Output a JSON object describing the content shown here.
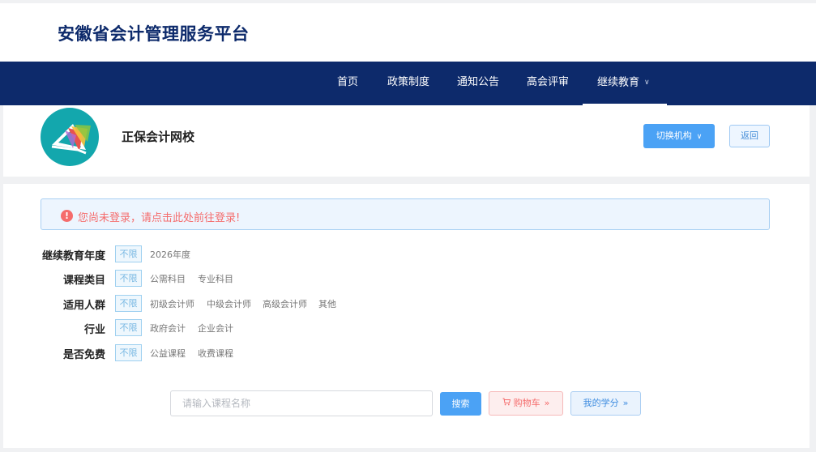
{
  "header": {
    "site_title": "安徽省会计管理服务平台"
  },
  "nav": {
    "items": [
      {
        "label": "首页"
      },
      {
        "label": "政策制度"
      },
      {
        "label": "通知公告"
      },
      {
        "label": "高会评审"
      },
      {
        "label": "继续教育"
      }
    ]
  },
  "org": {
    "name": "正保会计网校",
    "switch_label": "切换机构",
    "back_label": "返回"
  },
  "alert": {
    "prefix": "您尚未登录，请",
    "link": "点击此处",
    "suffix": "前往登录!"
  },
  "filters": [
    {
      "label": "继续教育年度",
      "all": "不限",
      "options": [
        "2026年度"
      ]
    },
    {
      "label": "课程类目",
      "all": "不限",
      "options": [
        "公需科目",
        "专业科目"
      ]
    },
    {
      "label": "适用人群",
      "all": "不限",
      "options": [
        "初级会计师",
        "中级会计师",
        "高级会计师",
        "其他"
      ]
    },
    {
      "label": "行业",
      "all": "不限",
      "options": [
        "政府会计",
        "企业会计"
      ]
    },
    {
      "label": "是否免费",
      "all": "不限",
      "options": [
        "公益课程",
        "收费课程"
      ]
    }
  ],
  "search": {
    "placeholder": "请输入课程名称",
    "search_label": "搜索",
    "cart_label": "购物车",
    "credits_label": "我的学分"
  },
  "colors": {
    "brand_navy": "#0d2a6b",
    "primary_blue": "#4ba2f5",
    "danger_red": "#f56c6c",
    "logo_teal": "#13a7ad"
  }
}
